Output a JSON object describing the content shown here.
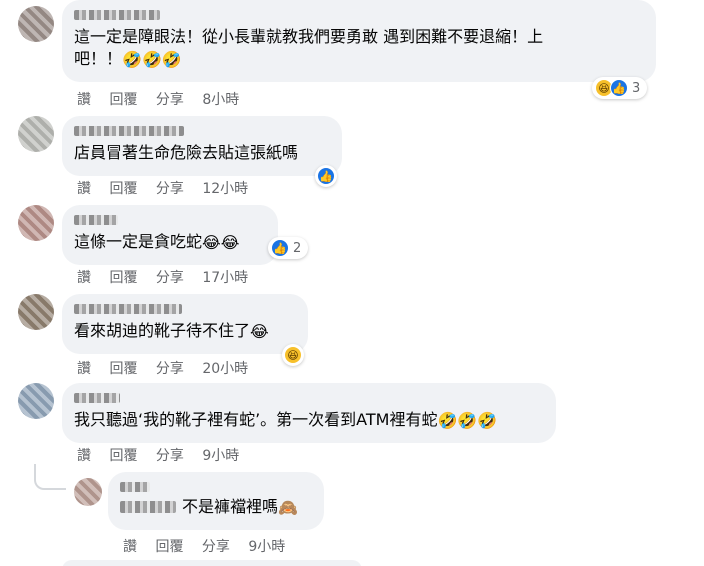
{
  "actions": {
    "like": "讚",
    "reply": "回覆",
    "share": "分享"
  },
  "comments": [
    {
      "text": "這一定是障眼法！從小長輩就教我們要勇敢 遇到困難不要退縮！上\n吧！！",
      "emoji": "🤣🤣🤣",
      "time": "8小時",
      "reaction_count": "3"
    },
    {
      "text": "店員冒著生命危險去貼這張紙嗎",
      "emoji": "",
      "time": "12小時",
      "reaction_count": ""
    },
    {
      "text": "這條一定是貪吃蛇",
      "emoji": "😂😂",
      "time": "17小時",
      "reaction_count": "2"
    },
    {
      "text": "看來胡迪的靴子待不住了",
      "emoji": "😂",
      "time": "20小時",
      "reaction_count": ""
    },
    {
      "text": "我只聽過‘我的靴子裡有蛇’。第一次看到ATM裡有蛇",
      "emoji": "🤣🤣🤣",
      "time": "9小時",
      "reaction_count": ""
    },
    {
      "text": "不是褲襠裡嗎",
      "emoji": "🙈",
      "time": "9小時",
      "reaction_count": ""
    }
  ],
  "icons": {
    "like": "like-icon",
    "haha": "haha-icon"
  },
  "colors": {
    "bubble": "#f0f2f5",
    "meta_text": "#65676b",
    "like_blue": "#1b74e4"
  }
}
